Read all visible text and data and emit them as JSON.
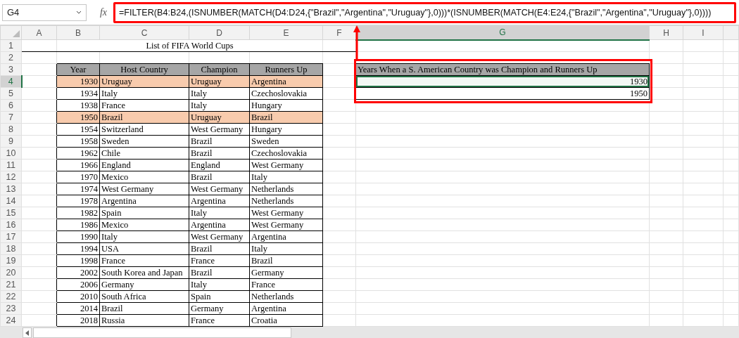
{
  "name_box": "G4",
  "formula": "=FILTER(B4:B24,(ISNUMBER(MATCH(D4:D24,{\"Brazil\",\"Argentina\",\"Uruguay\"},0)))*(ISNUMBER(MATCH(E4:E24,{\"Brazil\",\"Argentina\",\"Uruguay\"},0))))",
  "fx_label": "fx",
  "columns": [
    {
      "label": "A",
      "selected": false
    },
    {
      "label": "B",
      "selected": false
    },
    {
      "label": "C",
      "selected": false
    },
    {
      "label": "D",
      "selected": false
    },
    {
      "label": "E",
      "selected": false
    },
    {
      "label": "F",
      "selected": false
    },
    {
      "label": "G",
      "selected": true
    },
    {
      "label": "H",
      "selected": false
    },
    {
      "label": "I",
      "selected": false
    }
  ],
  "rows": [
    {
      "label": "1",
      "selected": false
    },
    {
      "label": "2",
      "selected": false
    },
    {
      "label": "3",
      "selected": false
    },
    {
      "label": "4",
      "selected": true
    },
    {
      "label": "5",
      "selected": false
    },
    {
      "label": "6",
      "selected": false
    },
    {
      "label": "7",
      "selected": false
    },
    {
      "label": "8",
      "selected": false
    },
    {
      "label": "9",
      "selected": false
    },
    {
      "label": "10",
      "selected": false
    },
    {
      "label": "11",
      "selected": false
    },
    {
      "label": "12",
      "selected": false
    },
    {
      "label": "13",
      "selected": false
    },
    {
      "label": "14",
      "selected": false
    },
    {
      "label": "15",
      "selected": false
    },
    {
      "label": "16",
      "selected": false
    },
    {
      "label": "17",
      "selected": false
    },
    {
      "label": "18",
      "selected": false
    },
    {
      "label": "19",
      "selected": false
    },
    {
      "label": "20",
      "selected": false
    },
    {
      "label": "21",
      "selected": false
    },
    {
      "label": "22",
      "selected": false
    },
    {
      "label": "23",
      "selected": false
    },
    {
      "label": "24",
      "selected": false
    }
  ],
  "title": "List of FIFA World Cups",
  "table": {
    "columns": [
      "Year",
      "Host Country",
      "Champion",
      "Runners Up"
    ],
    "rows": [
      {
        "year": "1930",
        "host": "Uruguay",
        "champion": "Uruguay",
        "runner_up": "Argentina",
        "highlighted": true
      },
      {
        "year": "1934",
        "host": "Italy",
        "champion": "Italy",
        "runner_up": "Czechoslovakia",
        "highlighted": false
      },
      {
        "year": "1938",
        "host": "France",
        "champion": "Italy",
        "runner_up": "Hungary",
        "highlighted": false
      },
      {
        "year": "1950",
        "host": "Brazil",
        "champion": "Uruguay",
        "runner_up": "Brazil",
        "highlighted": true
      },
      {
        "year": "1954",
        "host": "Switzerland",
        "champion": "West Germany",
        "runner_up": "Hungary",
        "highlighted": false
      },
      {
        "year": "1958",
        "host": "Sweden",
        "champion": "Brazil",
        "runner_up": "Sweden",
        "highlighted": false
      },
      {
        "year": "1962",
        "host": "Chile",
        "champion": "Brazil",
        "runner_up": "Czechoslovakia",
        "highlighted": false
      },
      {
        "year": "1966",
        "host": "England",
        "champion": "England",
        "runner_up": "West Germany",
        "highlighted": false
      },
      {
        "year": "1970",
        "host": "Mexico",
        "champion": "Brazil",
        "runner_up": "Italy",
        "highlighted": false
      },
      {
        "year": "1974",
        "host": "West Germany",
        "champion": "West Germany",
        "runner_up": "Netherlands",
        "highlighted": false
      },
      {
        "year": "1978",
        "host": "Argentina",
        "champion": "Argentina",
        "runner_up": "Netherlands",
        "highlighted": false
      },
      {
        "year": "1982",
        "host": "Spain",
        "champion": "Italy",
        "runner_up": "West Germany",
        "highlighted": false
      },
      {
        "year": "1986",
        "host": "Mexico",
        "champion": "Argentina",
        "runner_up": "West Germany",
        "highlighted": false
      },
      {
        "year": "1990",
        "host": "Italy",
        "champion": "West Germany",
        "runner_up": "Argentina",
        "highlighted": false
      },
      {
        "year": "1994",
        "host": "USA",
        "champion": "Brazil",
        "runner_up": "Italy",
        "highlighted": false
      },
      {
        "year": "1998",
        "host": "France",
        "champion": "France",
        "runner_up": "Brazil",
        "highlighted": false
      },
      {
        "year": "2002",
        "host": "South Korea and Japan",
        "champion": "Brazil",
        "runner_up": "Germany",
        "highlighted": false
      },
      {
        "year": "2006",
        "host": "Germany",
        "champion": "Italy",
        "runner_up": "France",
        "highlighted": false
      },
      {
        "year": "2010",
        "host": "South Africa",
        "champion": "Spain",
        "runner_up": "Netherlands",
        "highlighted": false
      },
      {
        "year": "2014",
        "host": "Brazil",
        "champion": "Germany",
        "runner_up": "Argentina",
        "highlighted": false
      },
      {
        "year": "2018",
        "host": "Russia",
        "champion": "France",
        "runner_up": "Croatia",
        "highlighted": false
      }
    ]
  },
  "result": {
    "header": "Years When a S. American Country was Champion and Runners Up",
    "values": [
      {
        "value": "1930",
        "selected": true
      },
      {
        "value": "1950",
        "selected": false
      }
    ]
  }
}
